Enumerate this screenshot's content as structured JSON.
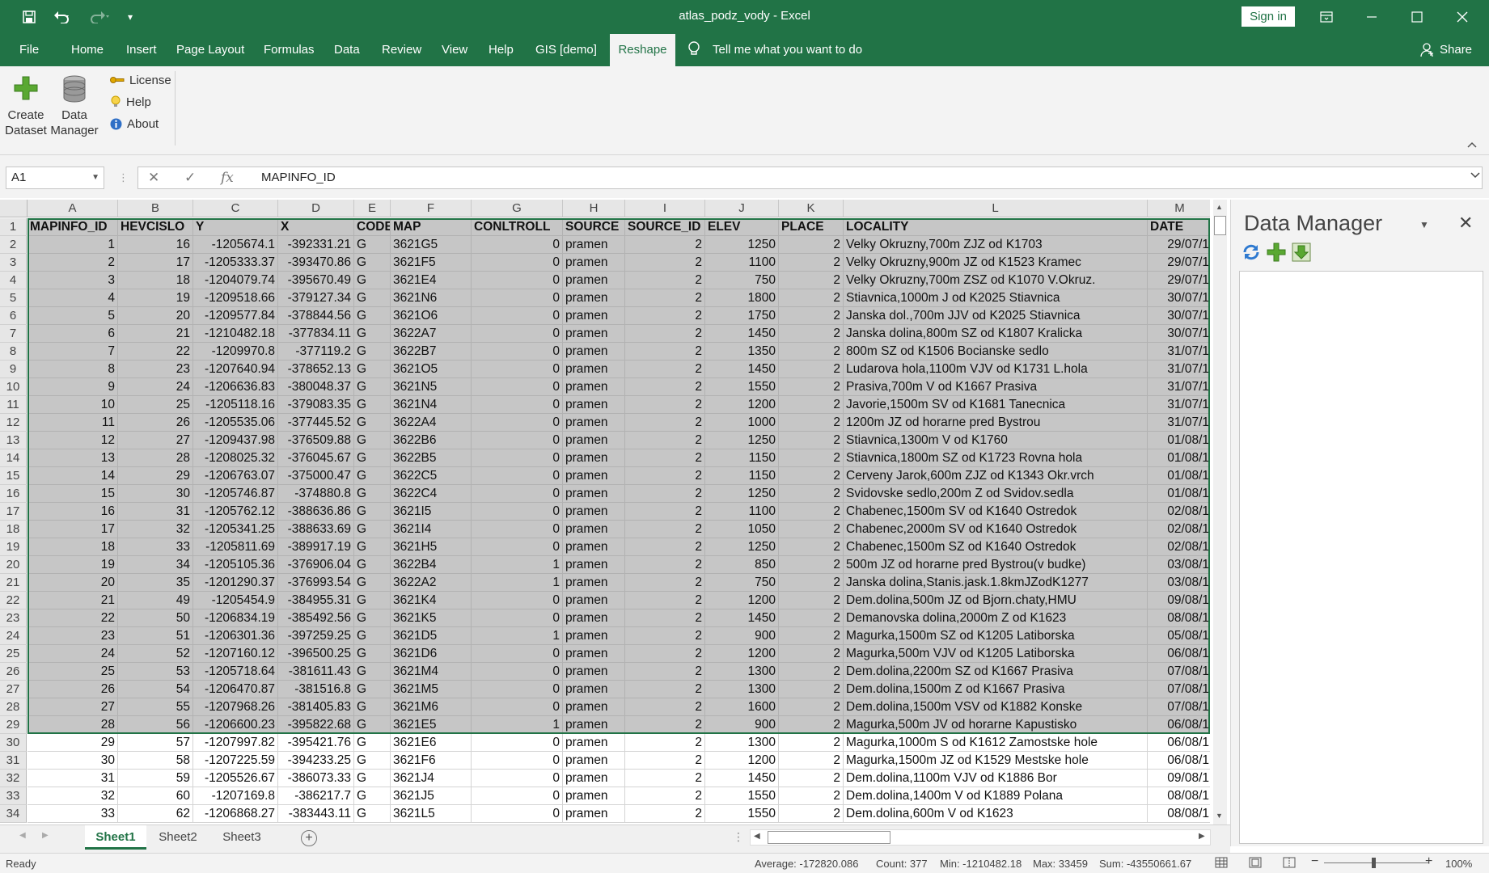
{
  "window": {
    "title": "atlas_podz_vody  -  Excel",
    "sign_in": "Sign in",
    "share": "Share"
  },
  "tabs": {
    "file": "File",
    "home": "Home",
    "insert": "Insert",
    "page_layout": "Page Layout",
    "formulas": "Formulas",
    "data": "Data",
    "review": "Review",
    "view": "View",
    "help": "Help",
    "gis": "GIS [demo]",
    "reshape": "Reshape",
    "tell_me": "Tell me what you want to do"
  },
  "ribbon": {
    "create_dataset_1": "Create",
    "create_dataset_2": "Dataset",
    "data_manager_1": "Data",
    "data_manager_2": "Manager",
    "license": "License",
    "help": "Help",
    "about": "About"
  },
  "formula_bar": {
    "name_box": "A1",
    "formula": "MAPINFO_ID"
  },
  "columns": [
    "A",
    "B",
    "C",
    "D",
    "E",
    "F",
    "G",
    "H",
    "I",
    "J",
    "K",
    "L",
    "M"
  ],
  "header_row": [
    "MAPINFO_ID",
    "HEVCISLO",
    "Y",
    "X",
    "CODE",
    "MAP",
    "CONLTROLL",
    "SOURCE",
    "SOURCE_ID",
    "ELEV",
    "PLACE",
    "LOCALITY",
    "DATE"
  ],
  "rows": [
    [
      "1",
      "16",
      "-1205674.1",
      "-392331.21",
      "G",
      "3621G5",
      "0",
      "pramen",
      "2",
      "1250",
      "2",
      "Velky Okruzny,700m ZJZ od K1703",
      "29/07/1"
    ],
    [
      "2",
      "17",
      "-1205333.37",
      "-393470.86",
      "G",
      "3621F5",
      "0",
      "pramen",
      "2",
      "1100",
      "2",
      "Velky Okruzny,900m JZ od K1523 Kramec",
      "29/07/1"
    ],
    [
      "3",
      "18",
      "-1204079.74",
      "-395670.49",
      "G",
      "3621E4",
      "0",
      "pramen",
      "2",
      "750",
      "2",
      "Velky Okruzny,700m ZSZ od K1070 V.Okruz.",
      "29/07/1"
    ],
    [
      "4",
      "19",
      "-1209518.66",
      "-379127.34",
      "G",
      "3621N6",
      "0",
      "pramen",
      "2",
      "1800",
      "2",
      "Stiavnica,1000m J od K2025 Stiavnica",
      "30/07/1"
    ],
    [
      "5",
      "20",
      "-1209577.84",
      "-378844.56",
      "G",
      "3621O6",
      "0",
      "pramen",
      "2",
      "1750",
      "2",
      "Janska dol.,700m JJV od K2025 Stiavnica",
      "30/07/1"
    ],
    [
      "6",
      "21",
      "-1210482.18",
      "-377834.11",
      "G",
      "3622A7",
      "0",
      "pramen",
      "2",
      "1450",
      "2",
      "Janska dolina,800m SZ od K1807 Kralicka",
      "30/07/1"
    ],
    [
      "7",
      "22",
      "-1209970.8",
      "-377119.2",
      "G",
      "3622B7",
      "0",
      "pramen",
      "2",
      "1350",
      "2",
      "800m SZ od K1506 Bocianske sedlo",
      "31/07/1"
    ],
    [
      "8",
      "23",
      "-1207640.94",
      "-378652.13",
      "G",
      "3621O5",
      "0",
      "pramen",
      "2",
      "1450",
      "2",
      "Ludarova hola,1100m VJV od K1731 L.hola",
      "31/07/1"
    ],
    [
      "9",
      "24",
      "-1206636.83",
      "-380048.37",
      "G",
      "3621N5",
      "0",
      "pramen",
      "2",
      "1550",
      "2",
      "Prasiva,700m V od K1667 Prasiva",
      "31/07/1"
    ],
    [
      "10",
      "25",
      "-1205118.16",
      "-379083.35",
      "G",
      "3621N4",
      "0",
      "pramen",
      "2",
      "1200",
      "2",
      "Javorie,1500m SV od K1681 Tanecnica",
      "31/07/1"
    ],
    [
      "11",
      "26",
      "-1205535.06",
      "-377445.52",
      "G",
      "3622A4",
      "0",
      "pramen",
      "2",
      "1000",
      "2",
      "1200m JZ od horarne pred Bystrou",
      "31/07/1"
    ],
    [
      "12",
      "27",
      "-1209437.98",
      "-376509.88",
      "G",
      "3622B6",
      "0",
      "pramen",
      "2",
      "1250",
      "2",
      "Stiavnica,1300m V od K1760",
      "01/08/1"
    ],
    [
      "13",
      "28",
      "-1208025.32",
      "-376045.67",
      "G",
      "3622B5",
      "0",
      "pramen",
      "2",
      "1150",
      "2",
      "Stiavnica,1800m SZ od K1723 Rovna hola",
      "01/08/1"
    ],
    [
      "14",
      "29",
      "-1206763.07",
      "-375000.47",
      "G",
      "3622C5",
      "0",
      "pramen",
      "2",
      "1150",
      "2",
      "Cerveny Jarok,600m ZJZ od K1343 Okr.vrch",
      "01/08/1"
    ],
    [
      "15",
      "30",
      "-1205746.87",
      "-374880.8",
      "G",
      "3622C4",
      "0",
      "pramen",
      "2",
      "1250",
      "2",
      "Svidovske sedlo,200m Z od Svidov.sedla",
      "01/08/1"
    ],
    [
      "16",
      "31",
      "-1205762.12",
      "-388636.86",
      "G",
      "3621I5",
      "0",
      "pramen",
      "2",
      "1100",
      "2",
      "Chabenec,1500m SV od K1640 Ostredok",
      "02/08/1"
    ],
    [
      "17",
      "32",
      "-1205341.25",
      "-388633.69",
      "G",
      "3621I4",
      "0",
      "pramen",
      "2",
      "1050",
      "2",
      "Chabenec,2000m SV od K1640 Ostredok",
      "02/08/1"
    ],
    [
      "18",
      "33",
      "-1205811.69",
      "-389917.19",
      "G",
      "3621H5",
      "0",
      "pramen",
      "2",
      "1250",
      "2",
      "Chabenec,1500m SZ od K1640 Ostredok",
      "02/08/1"
    ],
    [
      "19",
      "34",
      "-1205105.36",
      "-376906.04",
      "G",
      "3622B4",
      "1",
      "pramen",
      "2",
      "850",
      "2",
      "500m JZ od horarne pred Bystrou(v budke)",
      "03/08/1"
    ],
    [
      "20",
      "35",
      "-1201290.37",
      "-376993.54",
      "G",
      "3622A2",
      "1",
      "pramen",
      "2",
      "750",
      "2",
      "Janska dolina,Stanis.jask.1.8kmJZodK1277",
      "03/08/1"
    ],
    [
      "21",
      "49",
      "-1205454.9",
      "-384955.31",
      "G",
      "3621K4",
      "0",
      "pramen",
      "2",
      "1200",
      "2",
      "Dem.dolina,500m JZ od Bjorn.chaty,HMU",
      "09/08/1"
    ],
    [
      "22",
      "50",
      "-1206834.19",
      "-385492.56",
      "G",
      "3621K5",
      "0",
      "pramen",
      "2",
      "1450",
      "2",
      "Demanovska dolina,2000m Z od K1623",
      "08/08/1"
    ],
    [
      "23",
      "51",
      "-1206301.36",
      "-397259.25",
      "G",
      "3621D5",
      "1",
      "pramen",
      "2",
      "900",
      "2",
      "Magurka,1500m SZ od K1205 Latiborska",
      "05/08/1"
    ],
    [
      "24",
      "52",
      "-1207160.12",
      "-396500.25",
      "G",
      "3621D6",
      "0",
      "pramen",
      "2",
      "1200",
      "2",
      "Magurka,500m VJV od K1205 Latiborska",
      "06/08/1"
    ],
    [
      "25",
      "53",
      "-1205718.64",
      "-381611.43",
      "G",
      "3621M4",
      "0",
      "pramen",
      "2",
      "1300",
      "2",
      "Dem.dolina,2200m SZ od K1667 Prasiva",
      "07/08/1"
    ],
    [
      "26",
      "54",
      "-1206470.87",
      "-381516.8",
      "G",
      "3621M5",
      "0",
      "pramen",
      "2",
      "1300",
      "2",
      "Dem.dolina,1500m Z od K1667 Prasiva",
      "07/08/1"
    ],
    [
      "27",
      "55",
      "-1207968.26",
      "-381405.83",
      "G",
      "3621M6",
      "0",
      "pramen",
      "2",
      "1600",
      "2",
      "Dem.dolina,1500m VSV od K1882 Konske",
      "07/08/1"
    ],
    [
      "28",
      "56",
      "-1206600.23",
      "-395822.68",
      "G",
      "3621E5",
      "1",
      "pramen",
      "2",
      "900",
      "2",
      "Magurka,500m JV od horarne Kapustisko",
      "06/08/1"
    ],
    [
      "29",
      "57",
      "-1207997.82",
      "-395421.76",
      "G",
      "3621E6",
      "0",
      "pramen",
      "2",
      "1300",
      "2",
      "Magurka,1000m S od K1612 Zamostske hole",
      "06/08/1"
    ],
    [
      "30",
      "58",
      "-1207225.59",
      "-394233.25",
      "G",
      "3621F6",
      "0",
      "pramen",
      "2",
      "1200",
      "2",
      "Magurka,1500m JZ od K1529 Mestske hole",
      "06/08/1"
    ],
    [
      "31",
      "59",
      "-1205526.67",
      "-386073.33",
      "G",
      "3621J4",
      "0",
      "pramen",
      "2",
      "1450",
      "2",
      "Dem.dolina,1100m VJV od K1886 Bor",
      "09/08/1"
    ],
    [
      "32",
      "60",
      "-1207169.8",
      "-386217.7",
      "G",
      "3621J5",
      "0",
      "pramen",
      "2",
      "1550",
      "2",
      "Dem.dolina,1400m V od K1889 Polana",
      "08/08/1"
    ],
    [
      "33",
      "62",
      "-1206868.27",
      "-383443.11",
      "G",
      "3621L5",
      "0",
      "pramen",
      "2",
      "1550",
      "2",
      "Dem.dolina,600m V od K1623",
      "08/08/1"
    ]
  ],
  "data_manager": {
    "title": "Data Manager"
  },
  "sheets": [
    "Sheet1",
    "Sheet2",
    "Sheet3"
  ],
  "status": {
    "ready": "Ready",
    "average": "Average: -172820.086",
    "count": "Count: 377",
    "min": "Min: -1210482.18",
    "max": "Max: 33459",
    "sum": "Sum: -43550661.67",
    "zoom": "100%"
  },
  "colors": {
    "excel_green": "#217346",
    "selection": "#c6c6c6"
  }
}
